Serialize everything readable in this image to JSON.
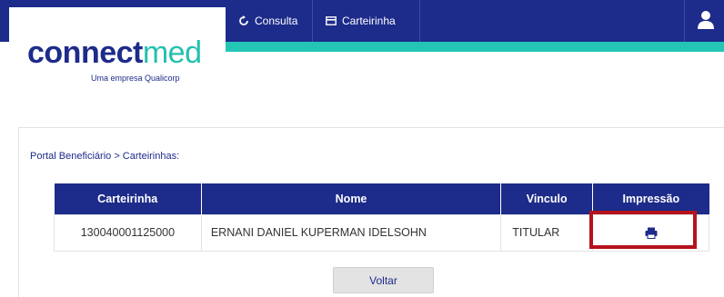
{
  "nav": {
    "items": [
      {
        "label": "Consulta",
        "icon": "refresh-icon"
      },
      {
        "label": "Carteirinha",
        "icon": "card-icon"
      }
    ],
    "user_icon": "user-icon"
  },
  "logo": {
    "bold": "connect",
    "light": "med",
    "subtitle": "Uma empresa Qualicorp"
  },
  "breadcrumb": "Portal Beneficiário > Carteirinhas:",
  "table": {
    "headers": [
      "Carteirinha",
      "Nome",
      "Vinculo",
      "Impressão"
    ],
    "rows": [
      {
        "carteirinha": "130040001125000",
        "nome": "ERNANI DANIEL KUPERMAN IDELSOHN",
        "vinculo": "TITULAR",
        "impressao_icon": "print-icon"
      }
    ]
  },
  "back_button": "Voltar",
  "colors": {
    "primary": "#1d2b8a",
    "accent": "#24c0b0",
    "highlight": "#b5121b"
  }
}
